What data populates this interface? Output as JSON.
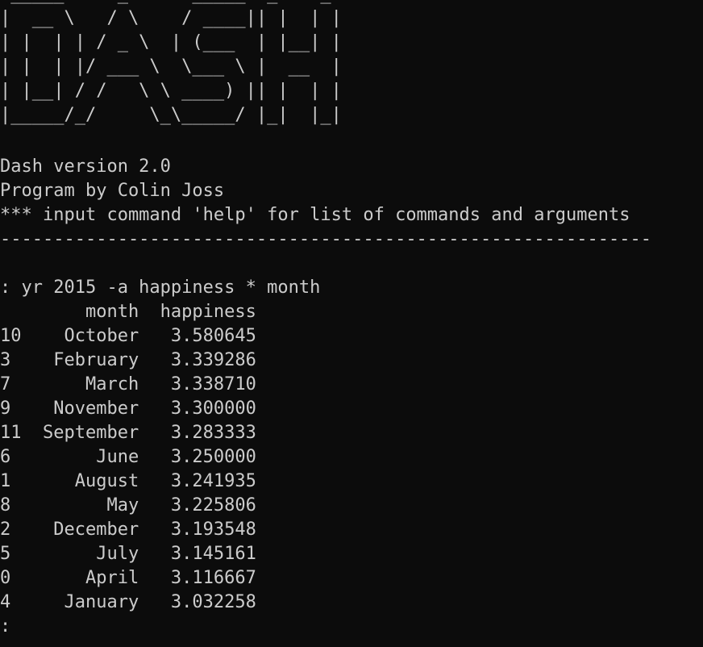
{
  "banner": [
    " _____     _      _____  _    _ ",
    "|  __ \\   / \\    / ____|| |  | |",
    "| |  | | / _ \\  | (___  | |__| |",
    "| |  | |/ ___ \\  \\___ \\ |  __  |",
    "| |__| / /   \\ \\ ____) || |  | |",
    "|_____/_/     \\_\\_____/ |_|  |_|"
  ],
  "header": {
    "version": "Dash version 2.0",
    "author": "Program by Colin Joss",
    "hint": "*** input command 'help' for list of commands and arguments",
    "separator": "-------------------------------------------------------------"
  },
  "command": ": yr 2015 -a happiness * month",
  "table": {
    "header": "        month  happiness",
    "rows": [
      "10    October   3.580645",
      "3    February   3.339286",
      "7       March   3.338710",
      "9    November   3.300000",
      "11  September   3.283333",
      "6        June   3.250000",
      "1      August   3.241935",
      "8         May   3.225806",
      "2    December   3.193548",
      "5        July   3.145161",
      "0       April   3.116667",
      "4     January   3.032258"
    ]
  },
  "prompt": ":",
  "colors": {
    "background": "#0c0c0c",
    "text": "#cccccc"
  }
}
